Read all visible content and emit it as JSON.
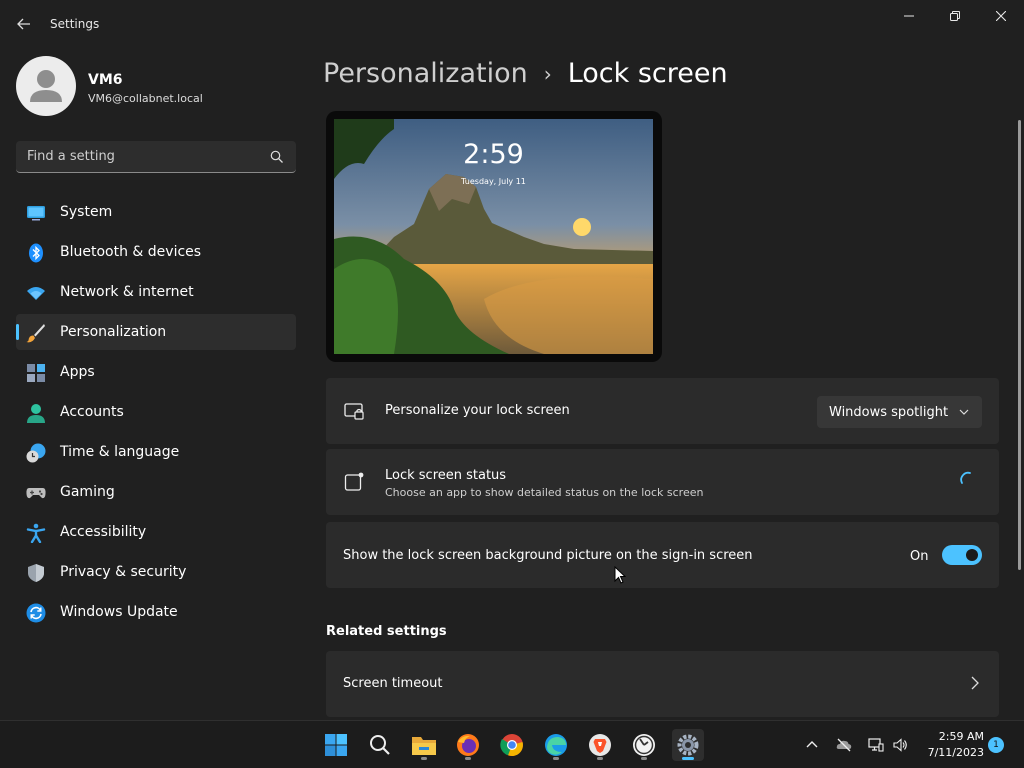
{
  "window": {
    "app_title": "Settings",
    "back_icon": "back-arrow-icon",
    "controls": [
      "minimize-icon",
      "maximize-icon",
      "close-icon"
    ]
  },
  "user": {
    "name": "VM6",
    "email": "VM6@collabnet.local"
  },
  "search": {
    "placeholder": "Find a setting",
    "value": ""
  },
  "sidebar": {
    "selected": "Personalization",
    "items": [
      {
        "label": "System",
        "icon": "system-monitor-icon"
      },
      {
        "label": "Bluetooth & devices",
        "icon": "bluetooth-icon"
      },
      {
        "label": "Network & internet",
        "icon": "wifi-icon"
      },
      {
        "label": "Personalization",
        "icon": "paintbrush-icon"
      },
      {
        "label": "Apps",
        "icon": "apps-icon"
      },
      {
        "label": "Accounts",
        "icon": "person-icon"
      },
      {
        "label": "Time & language",
        "icon": "clock-globe-icon"
      },
      {
        "label": "Gaming",
        "icon": "gamepad-icon"
      },
      {
        "label": "Accessibility",
        "icon": "accessibility-icon"
      },
      {
        "label": "Privacy & security",
        "icon": "shield-icon"
      },
      {
        "label": "Windows Update",
        "icon": "update-icon"
      }
    ]
  },
  "page": {
    "breadcrumb_parent": "Personalization",
    "breadcrumb_current": "Lock screen"
  },
  "preview": {
    "time": "2:59",
    "date": "Tuesday, July 11"
  },
  "settings": {
    "personalize": {
      "title": "Personalize your lock screen",
      "dropdown_value": "Windows spotlight"
    },
    "status": {
      "title": "Lock screen status",
      "description": "Choose an app to show detailed status on the lock screen"
    },
    "signin_background": {
      "title": "Show the lock screen background picture on the sign-in screen",
      "state_label": "On",
      "enabled": true
    }
  },
  "related": {
    "title": "Related settings",
    "items": [
      {
        "label": "Screen timeout"
      }
    ]
  },
  "taskbar": {
    "apps": [
      "start-icon",
      "search-icon",
      "file-explorer-icon",
      "firefox-icon",
      "chrome-icon",
      "edge-icon",
      "brave-icon",
      "clock-app-icon",
      "settings-icon"
    ],
    "time": "2:59 AM",
    "date": "7/11/2023",
    "notification_count": "1"
  },
  "colors": {
    "accent": "#4cc2ff",
    "background": "#202020",
    "card": "#2b2b2b"
  }
}
